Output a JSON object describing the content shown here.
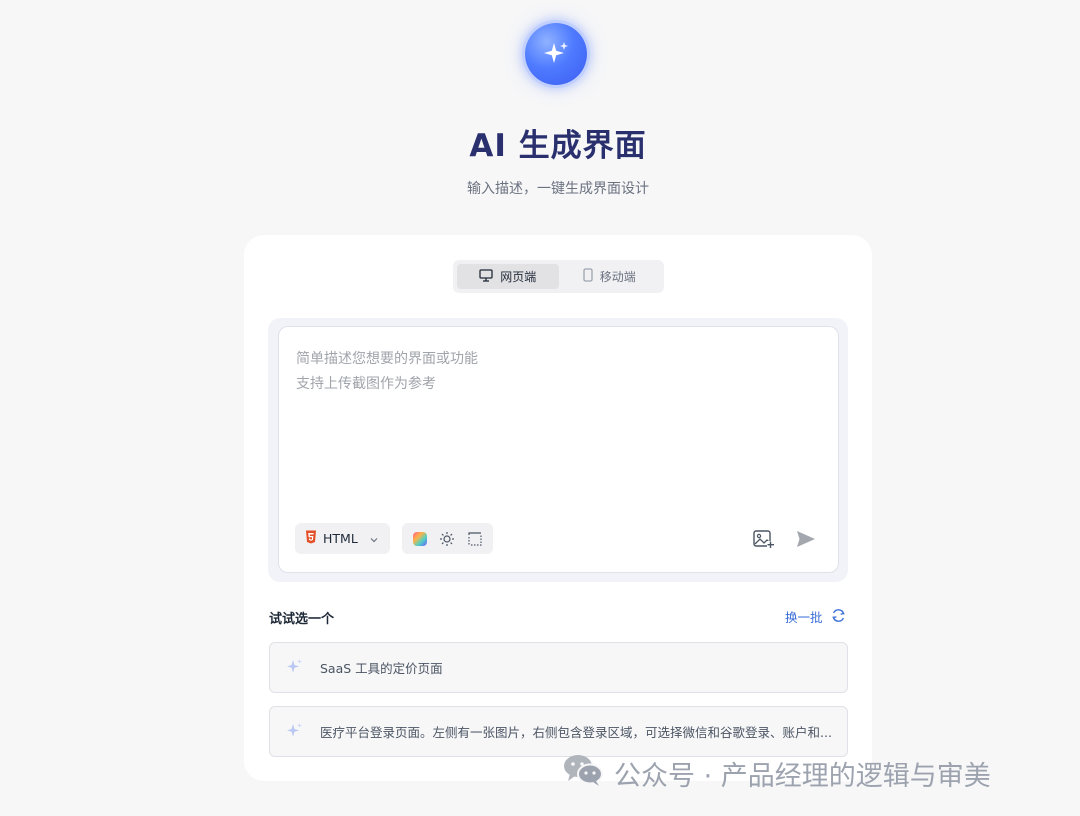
{
  "header": {
    "title": "AI 生成界面",
    "subtitle": "输入描述，一键生成界面设计",
    "logo_icon": "sparkle-icon"
  },
  "platform_tabs": [
    {
      "label": "网页端",
      "icon": "monitor-icon",
      "active": true
    },
    {
      "label": "移动端",
      "icon": "mobile-icon",
      "active": false
    }
  ],
  "editor": {
    "placeholder_line1": "简单描述您想要的界面或功能",
    "placeholder_line2": "支持上传截图作为参考",
    "format_label": "HTML",
    "format_icon": "html5-icon",
    "tools": [
      "color-palette-icon",
      "theme-sun-icon",
      "layout-frame-icon"
    ],
    "upload_icon": "image-upload-icon",
    "send_icon": "send-icon"
  },
  "suggestions": {
    "label": "试试选一个",
    "refresh_label": "换一批",
    "items": [
      "SaaS 工具的定价页面",
      "医疗平台登录页面。左侧有一张图片，右侧包含登录区域，可选择微信和谷歌登录、账户和..."
    ]
  },
  "watermark": {
    "text": "公众号 · 产品经理的逻辑与审美",
    "icon": "wechat-icon"
  },
  "colors": {
    "accent": "#3b6fd8",
    "title": "#2a2f6e",
    "logo": "#4f7bff"
  }
}
